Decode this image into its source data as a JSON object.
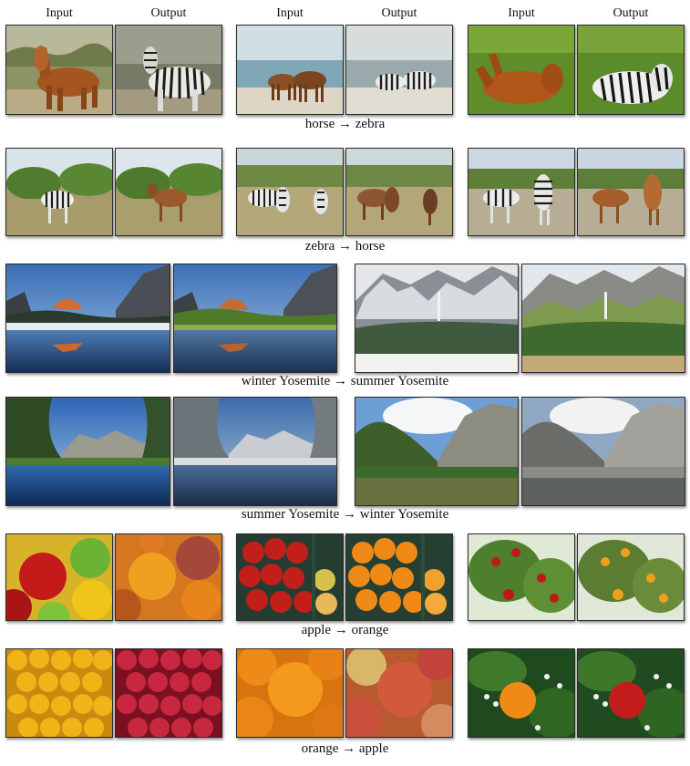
{
  "column_headers": [
    "Input",
    "Output",
    "Input",
    "Output",
    "Input",
    "Output"
  ],
  "captions": {
    "horse_to_zebra": "horse → zebra",
    "zebra_to_horse": "zebra → horse",
    "winter_to_summer": "winter Yosemite → summer Yosemite",
    "summer_to_winter": "summer Yosemite → winter Yosemite",
    "apple_to_orange": "apple → orange",
    "orange_to_apple": "orange → apple"
  }
}
